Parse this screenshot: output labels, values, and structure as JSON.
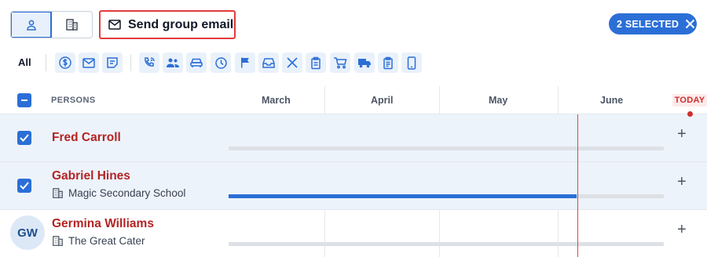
{
  "toolbar": {
    "view_toggle": [
      "person-icon",
      "building-icon"
    ],
    "send_group_email": "Send group email",
    "selected_badge": "2 SELECTED"
  },
  "filters": {
    "all_label": "All",
    "icons": [
      "dollar-icon",
      "mail-icon",
      "note-icon",
      "phone-call-icon",
      "people-icon",
      "car-icon",
      "clock-icon",
      "flag-icon",
      "inbox-icon",
      "utensils-icon",
      "clipboard-icon",
      "cart-icon",
      "truck-icon",
      "checklist-icon",
      "mobile-icon"
    ]
  },
  "table": {
    "persons_header": "PERSONS",
    "months": [
      "March",
      "April",
      "May",
      "June"
    ],
    "today_label": "TODAY",
    "rows": [
      {
        "name": "Fred Carroll",
        "organization": "",
        "selected": true,
        "progress": 0
      },
      {
        "name": "Gabriel Hines",
        "organization": "Magic Secondary School",
        "selected": true,
        "progress": 0.8
      },
      {
        "name": "Germina Williams",
        "organization": "The Great Cater",
        "selected": false,
        "avatar": "GW",
        "progress": 0
      }
    ]
  },
  "colors": {
    "accent": "#2b6fd6",
    "name_red": "#b42323",
    "today_red": "#d22e2e",
    "selected_row": "#edf3fb"
  }
}
